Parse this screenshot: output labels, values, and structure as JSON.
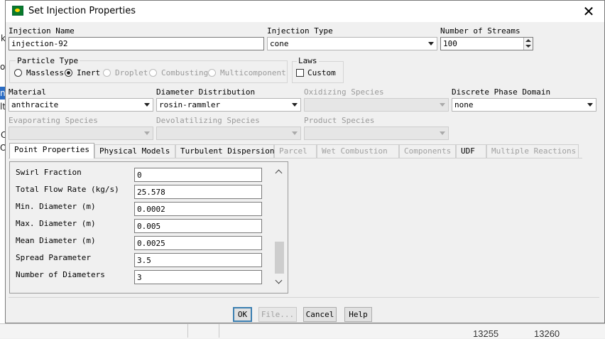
{
  "window": {
    "title": "Set Injection Properties",
    "close_glyph": "✕"
  },
  "background": {
    "fragments": [
      "k",
      "of",
      "n",
      "lt",
      "C",
      "Ol"
    ],
    "bottom_numbers": [
      "13255",
      "13260",
      ""
    ]
  },
  "injection_name": {
    "label": "Injection Name",
    "value": "injection-92"
  },
  "injection_type": {
    "label": "Injection Type",
    "value": "cone"
  },
  "number_of_streams": {
    "label": "Number of Streams",
    "value": "100"
  },
  "particle_type": {
    "label": "Particle Type",
    "options": [
      "Massless",
      "Inert",
      "Droplet",
      "Combusting",
      "Multicomponent"
    ],
    "selected": "Inert"
  },
  "laws": {
    "label": "Laws",
    "custom_label": "Custom",
    "custom_checked": false
  },
  "material": {
    "label": "Material",
    "value": "anthracite"
  },
  "diameter_distribution": {
    "label": "Diameter Distribution",
    "value": "rosin-rammler"
  },
  "oxidizing_species": {
    "label": "Oxidizing Species",
    "value": ""
  },
  "discrete_phase_domain": {
    "label": "Discrete Phase Domain",
    "value": "none"
  },
  "evaporating_species": {
    "label": "Evaporating Species",
    "value": ""
  },
  "devolatilizing_species": {
    "label": "Devolatilizing Species",
    "value": ""
  },
  "product_species": {
    "label": "Product Species",
    "value": ""
  },
  "tabs": [
    "Point Properties",
    "Physical Models",
    "Turbulent Dispersion",
    "Parcel",
    "Wet Combustion",
    "Components",
    "UDF",
    "Multiple Reactions"
  ],
  "active_tab": "Point Properties",
  "properties": [
    {
      "label": "Swirl Fraction",
      "value": "0"
    },
    {
      "label": "Total Flow Rate (kg/s)",
      "value": "25.578"
    },
    {
      "label": "Min. Diameter (m)",
      "value": "0.0002"
    },
    {
      "label": "Max. Diameter (m)",
      "value": "0.005"
    },
    {
      "label": "Mean Diameter (m)",
      "value": "0.0025"
    },
    {
      "label": "Spread Parameter",
      "value": "3.5"
    },
    {
      "label": "Number of Diameters",
      "value": "3"
    }
  ],
  "buttons": {
    "ok": "OK",
    "file": "File...",
    "cancel": "Cancel",
    "help": "Help"
  }
}
